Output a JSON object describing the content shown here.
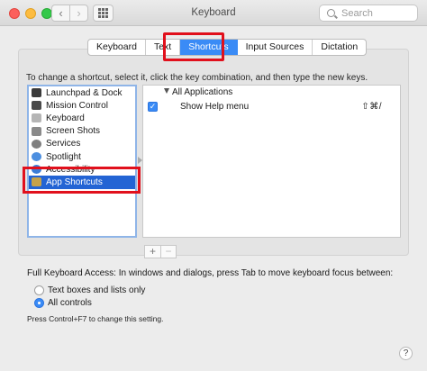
{
  "window": {
    "title": "Keyboard"
  },
  "search": {
    "placeholder": "Search"
  },
  "tabs": [
    {
      "label": "Keyboard",
      "active": false
    },
    {
      "label": "Text",
      "active": false
    },
    {
      "label": "Shortcuts",
      "active": true
    },
    {
      "label": "Input Sources",
      "active": false
    },
    {
      "label": "Dictation",
      "active": false
    }
  ],
  "instructions": "To change a shortcut, select it, click the key combination, and then type the new keys.",
  "categories": [
    {
      "label": "Launchpad & Dock",
      "icon": "launchpad-icon",
      "color": "#3b3b3b"
    },
    {
      "label": "Mission Control",
      "icon": "mission-control-icon",
      "color": "#4a4a4a"
    },
    {
      "label": "Keyboard",
      "icon": "keyboard-icon",
      "color": "#b5b5b5"
    },
    {
      "label": "Screen Shots",
      "icon": "screenshot-icon",
      "color": "#8a8a8a"
    },
    {
      "label": "Services",
      "icon": "gear-icon",
      "color": "#7f7f7f"
    },
    {
      "label": "Spotlight",
      "icon": "spotlight-icon",
      "color": "#4d8fe0"
    },
    {
      "label": "Accessibility",
      "icon": "accessibility-icon",
      "color": "#3b7dd8"
    },
    {
      "label": "App Shortcuts",
      "icon": "app-shortcuts-icon",
      "color": "#c6a24a",
      "selected": true
    }
  ],
  "shortcuts": {
    "group": "All Applications",
    "items": [
      {
        "label": "Show Help menu",
        "keys": "⇧⌘/",
        "checked": true
      }
    ]
  },
  "buttons": {
    "add": "+",
    "remove": "−"
  },
  "full_keyboard_access": {
    "title": "Full Keyboard Access: In windows and dialogs, press Tab to move keyboard focus between:",
    "options": [
      {
        "label": "Text boxes and lists only",
        "selected": false
      },
      {
        "label": "All controls",
        "selected": true
      }
    ],
    "hint": "Press Control+F7 to change this setting."
  },
  "help": "?",
  "colors": {
    "accent": "#3a8bf6",
    "selection": "#2364d4",
    "highlight": "#e1101c"
  }
}
